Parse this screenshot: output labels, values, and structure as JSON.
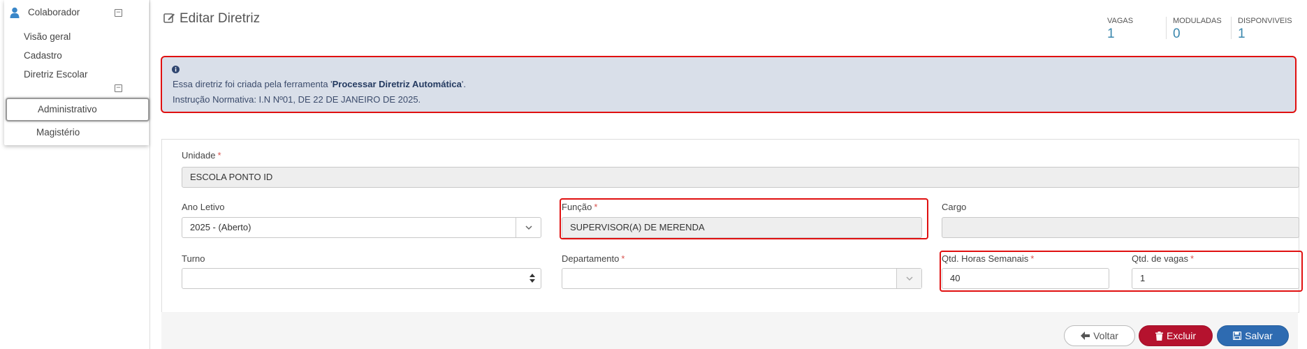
{
  "sidebar": {
    "header_label": "Colaborador",
    "items": [
      {
        "label": "Visão geral"
      },
      {
        "label": "Cadastro"
      },
      {
        "label": "Diretriz Escolar"
      },
      {
        "label": "Administrativo"
      },
      {
        "label": "Magistério"
      }
    ]
  },
  "page": {
    "title": "Editar Diretriz"
  },
  "stats": [
    {
      "label": "VAGAS",
      "value": "1"
    },
    {
      "label": "MODULADAS",
      "value": "0"
    },
    {
      "label": "DISPONVIVEIS",
      "value": "1"
    }
  ],
  "alert": {
    "line1_prefix": "Essa diretriz foi criada pela ferramenta '",
    "line1_bold": "Processar Diretriz Automática",
    "line1_suffix": "'.",
    "line2": "Instrução Normativa: I.N Nº01, DE 22 DE JANEIRO DE 2025."
  },
  "form": {
    "required_mark": "*",
    "unidade": {
      "label": "Unidade",
      "value": "ESCOLA PONTO ID"
    },
    "ano_letivo": {
      "label": "Ano Letivo",
      "value": "2025 - (Aberto)"
    },
    "funcao": {
      "label": "Função",
      "value": "SUPERVISOR(A) DE MERENDA"
    },
    "cargo": {
      "label": "Cargo",
      "value": ""
    },
    "turno": {
      "label": "Turno",
      "value": ""
    },
    "departamento": {
      "label": "Departamento",
      "value": ""
    },
    "horas_semanais": {
      "label": "Qtd. Horas Semanais",
      "value": "40"
    },
    "qtd_vagas": {
      "label": "Qtd. de vagas",
      "value": "1"
    }
  },
  "buttons": {
    "voltar": "Voltar",
    "excluir": "Excluir",
    "salvar": "Salvar"
  },
  "colors": {
    "accent": "#3a87ad",
    "danger": "#b5122e",
    "primary": "#2e6bb1",
    "highlight": "#e01010",
    "alert_bg": "#d9dfe9"
  }
}
